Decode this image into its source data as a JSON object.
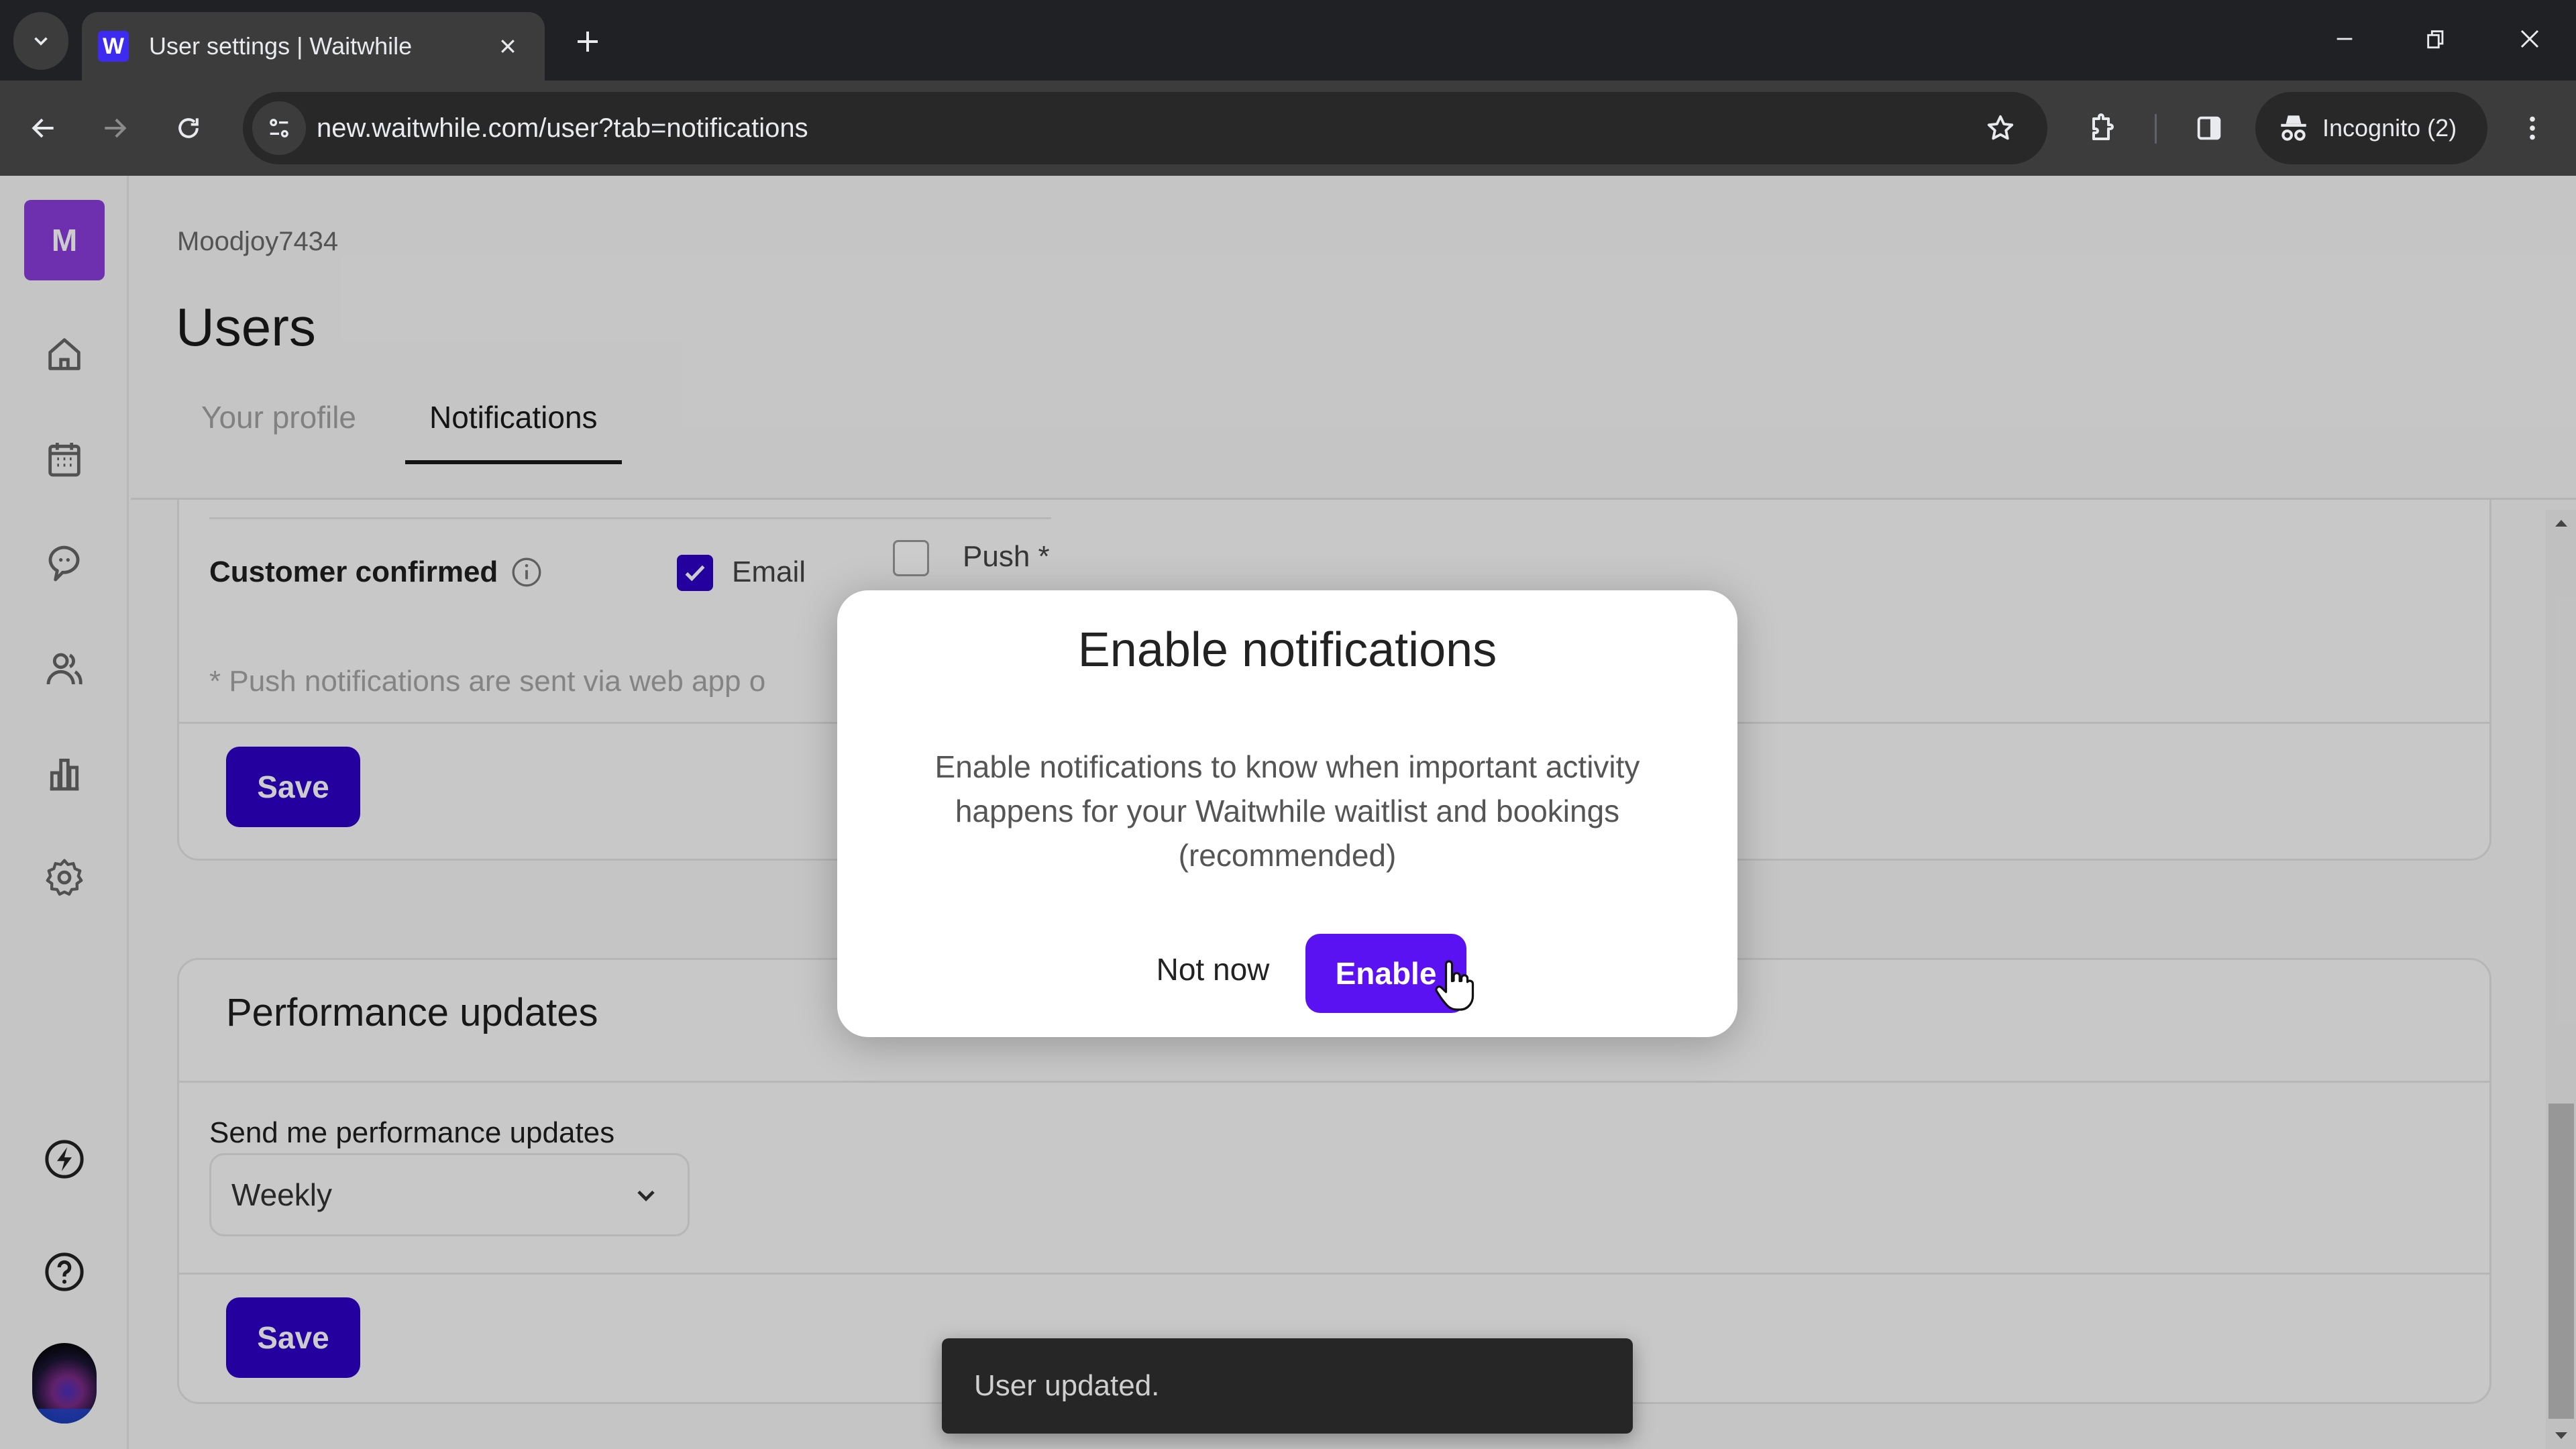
{
  "browser": {
    "tab_title": "User settings | Waitwhile",
    "favicon_letter": "W",
    "url": "new.waitwhile.com/user?tab=notifications",
    "incognito_label": "Incognito (2)",
    "icons": [
      "tab-search-icon",
      "close-icon",
      "new-tab-icon",
      "minimize-icon",
      "restore-icon",
      "window-close-icon",
      "back-icon",
      "forward-icon",
      "reload-icon",
      "site-info-icon",
      "bookmark-star-icon",
      "extensions-icon",
      "side-panel-icon",
      "incognito-icon",
      "more-menu-icon"
    ]
  },
  "sidebar": {
    "logo_letter": "M",
    "items": [
      {
        "name": "home",
        "icon": "home-icon"
      },
      {
        "name": "calendar",
        "icon": "calendar-icon"
      },
      {
        "name": "messages",
        "icon": "chat-icon"
      },
      {
        "name": "customers",
        "icon": "users-icon"
      },
      {
        "name": "analytics",
        "icon": "bar-chart-icon"
      },
      {
        "name": "settings",
        "icon": "gear-icon"
      },
      {
        "name": "whats-new",
        "icon": "lightning-icon"
      },
      {
        "name": "help",
        "icon": "help-icon"
      }
    ],
    "avatar": "user-avatar"
  },
  "header": {
    "breadcrumb": "Moodjoy7434",
    "title": "Users",
    "tabs": [
      {
        "label": "Your profile",
        "active": false
      },
      {
        "label": "Notifications",
        "active": true
      }
    ]
  },
  "notifications_card": {
    "row_label": "Customer confirmed",
    "options": [
      {
        "label": "Email",
        "checked": true
      },
      {
        "label": "Push *",
        "checked": false
      }
    ],
    "note": "* Push notifications are sent via web app o",
    "save_label": "Save"
  },
  "performance_card": {
    "title": "Performance updates",
    "field_label": "Send me performance updates",
    "select_value": "Weekly",
    "save_label": "Save"
  },
  "modal": {
    "title": "Enable notifications",
    "body": "Enable notifications to know when important activity happens for your Waitwhile waitlist and bookings (recommended)",
    "cancel_label": "Not now",
    "confirm_label": "Enable"
  },
  "toast": {
    "message": "User updated."
  },
  "colors": {
    "primary": "#2d00c7",
    "modal_accent": "#5b12f2",
    "logo": "#8b3ddb"
  }
}
